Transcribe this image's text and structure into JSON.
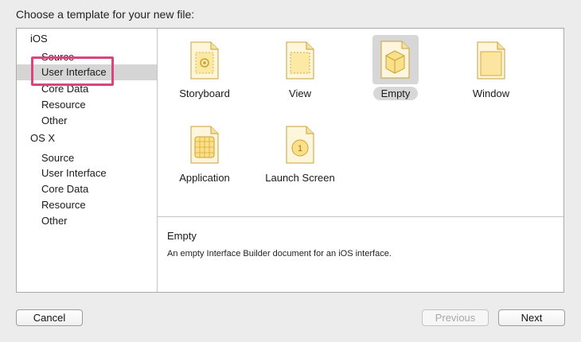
{
  "dialog": {
    "prompt": "Choose a template for your new file:"
  },
  "sidebar": {
    "sections": [
      {
        "label": "iOS",
        "items": [
          "Source",
          "User Interface",
          "Core Data",
          "Resource",
          "Other"
        ]
      },
      {
        "label": "OS X",
        "items": [
          "Source",
          "User Interface",
          "Core Data",
          "Resource",
          "Other"
        ]
      }
    ],
    "selected_item": "User Interface"
  },
  "templates": [
    {
      "label": "Storyboard",
      "icon": "storyboard-icon"
    },
    {
      "label": "View",
      "icon": "view-icon"
    },
    {
      "label": "Empty",
      "icon": "empty-icon",
      "selected": true
    },
    {
      "label": "Window",
      "icon": "window-icon"
    },
    {
      "label": "Application",
      "icon": "application-icon"
    },
    {
      "label": "Launch Screen",
      "icon": "launch-screen-icon"
    }
  ],
  "description": {
    "title": "Empty",
    "text": "An empty Interface Builder document for an iOS interface."
  },
  "buttons": {
    "cancel": "Cancel",
    "previous": "Previous",
    "next": "Next"
  },
  "icon_badge": "1",
  "colors": {
    "highlight": "#d9467e",
    "icon_fill": "#fbe9a4",
    "icon_stroke": "#e0b43a"
  }
}
